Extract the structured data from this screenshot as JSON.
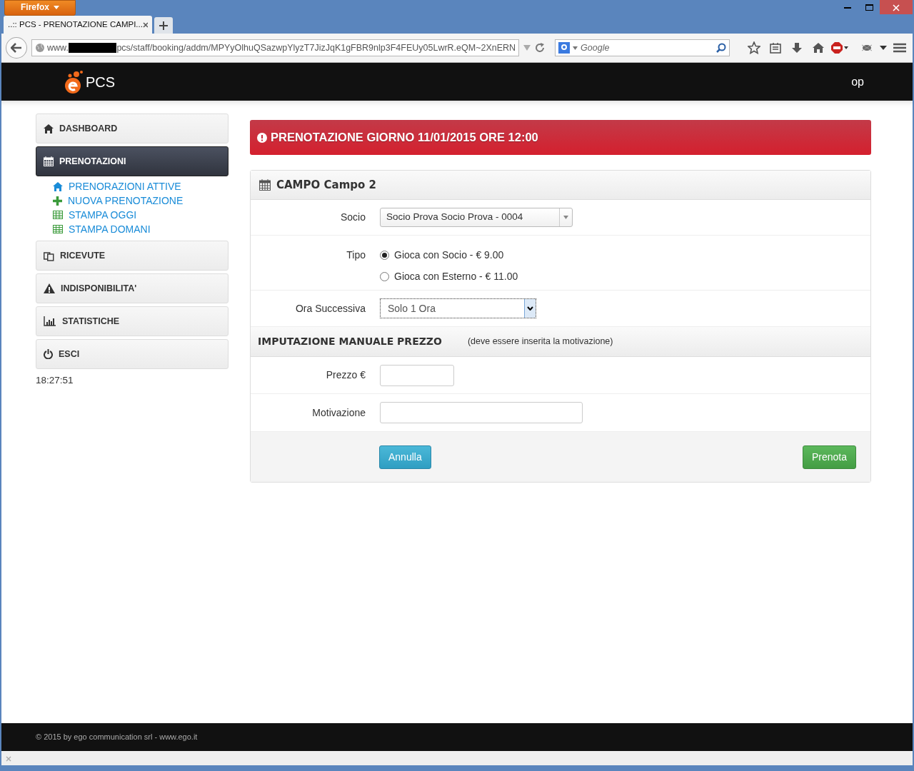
{
  "browser": {
    "menu_button": "Firefox",
    "tab": {
      "title": "..:: PCS - PRENOTAZIONE CAMPI..."
    },
    "url_prefix": "www.",
    "url_path": "pcs/staff/booking/addm/MPYyOlhuQSazwpYlyzT7JizJqK1gFBR9nlp3F4FEUy05LwrR.eQM~2XnERN",
    "search_placeholder": "Google"
  },
  "navbar": {
    "brand": "PCS",
    "user": "op"
  },
  "sidebar": {
    "items": [
      {
        "label": "DASHBOARD",
        "selected": false
      },
      {
        "label": "PRENOTAZIONI",
        "selected": true,
        "children": [
          {
            "label": "PRENORAZIONI ATTIVE"
          },
          {
            "label": "NUOVA PRENOTAZIONE"
          },
          {
            "label": "STAMPA OGGI"
          },
          {
            "label": "STAMPA DOMANI"
          }
        ]
      },
      {
        "label": "RICEVUTE",
        "selected": false
      },
      {
        "label": "INDISPONIBILITA'",
        "selected": false
      },
      {
        "label": "STATISTICHE",
        "selected": false
      },
      {
        "label": "ESCI",
        "selected": false
      }
    ],
    "clock": "18:27:51"
  },
  "alert": "PRENOTAZIONE GIORNO 11/01/2015 ORE 12:00",
  "panel": {
    "title": "CAMPO Campo 2",
    "socio": {
      "label": "Socio",
      "value": "Socio Prova Socio Prova - 0004"
    },
    "tipo": {
      "label": "Tipo",
      "options": [
        {
          "label": "Gioca con Socio - € 9.00",
          "selected": true
        },
        {
          "label": "Gioca con Esterno - € 11.00",
          "selected": false
        }
      ]
    },
    "ora": {
      "label": "Ora Successiva",
      "value": "Solo 1 Ora"
    },
    "manual": {
      "title": "IMPUTAZIONE MANUALE PREZZO",
      "note": "(deve essere inserita la motivazione)"
    },
    "prezzo": {
      "label": "Prezzo €"
    },
    "motivazione": {
      "label": "Motivazione"
    },
    "buttons": [
      {
        "label": "Annulla",
        "kind": "cancel"
      },
      {
        "label": "Prenota",
        "kind": "submit"
      }
    ]
  },
  "footer": "© 2015 by ego communication srl - www.ego.it"
}
